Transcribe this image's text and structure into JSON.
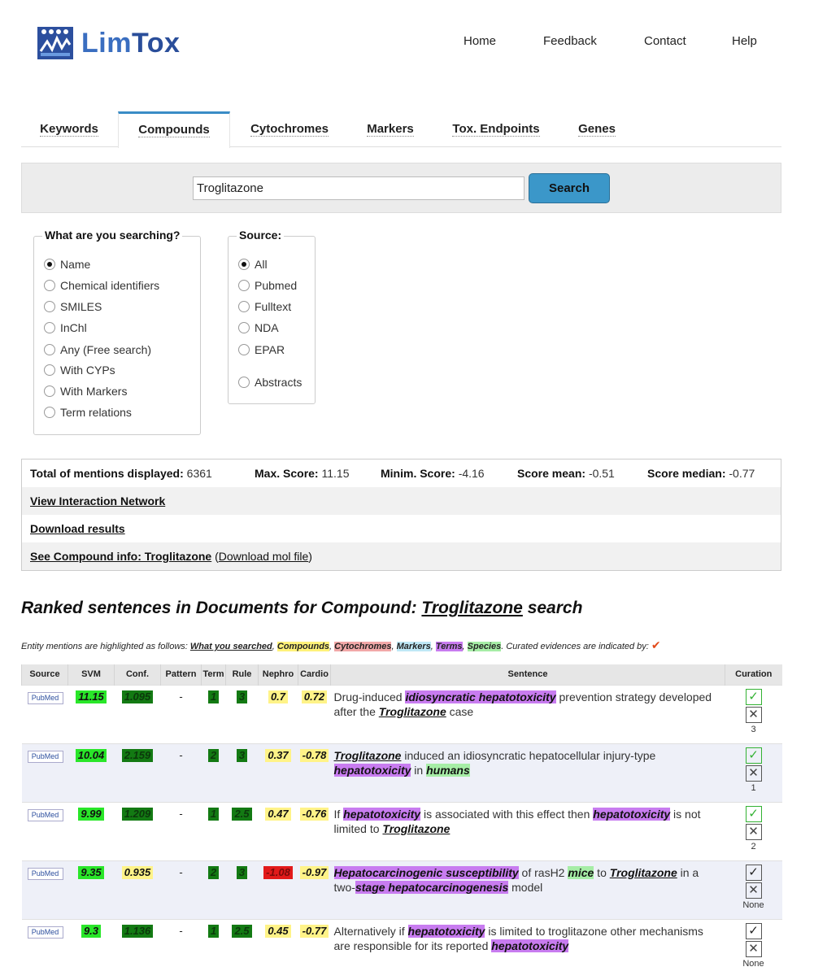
{
  "header": {
    "logo_lim": "Lim",
    "logo_tox": "Tox",
    "nav": [
      "Home",
      "Feedback",
      "Contact",
      "Help"
    ]
  },
  "tabs": [
    "Keywords",
    "Compounds",
    "Cytochromes",
    "Markers",
    "Tox. Endpoints",
    "Genes"
  ],
  "active_tab": "Compounds",
  "search": {
    "value": "Troglitazone",
    "button": "Search"
  },
  "searching": {
    "legend": "What are you searching?",
    "options": [
      "Name",
      "Chemical identifiers",
      "SMILES",
      "InChl",
      "Any (Free search)",
      "With CYPs",
      "With Markers",
      "Term relations"
    ],
    "selected": "Name"
  },
  "source": {
    "legend": "Source:",
    "options": [
      "All",
      "Pubmed",
      "Fulltext",
      "NDA",
      "EPAR",
      "Abstracts"
    ],
    "selected": "All"
  },
  "stats": {
    "total_label": "Total of mentions displayed:",
    "total": "6361",
    "max_label": "Max. Score:",
    "max": "11.15",
    "min_label": "Minim. Score:",
    "min": "-4.16",
    "mean_label": "Score mean:",
    "mean": "-0.51",
    "median_label": "Score median:",
    "median": "-0.77",
    "link_network": "View Interaction Network",
    "link_download": "Download results",
    "link_compound": "See Compound info: Troglitazone",
    "link_mol": "Download mol file"
  },
  "ranked": {
    "title_prefix": "Ranked sentences in Documents for Compound: ",
    "compound": "Troglitazone",
    "title_suffix": " search",
    "legend_intro": "Entity mentions are highlighted as follows: ",
    "legend_items": [
      "What you searched",
      "Compounds",
      "Cytochromes",
      "Markers",
      "Terms",
      "Species"
    ],
    "legend_outro": ". Curated evidences are indicated by: ",
    "check": "✔"
  },
  "table": {
    "headers": [
      "Source",
      "SVM",
      "Conf.",
      "Pattern",
      "Term",
      "Rule",
      "Nephro",
      "Cardio",
      "Sentence",
      "Curation"
    ],
    "source_badge": "PubMed",
    "rows": [
      {
        "svm": "11.15",
        "conf": "1.095",
        "pattern": "-",
        "term": "1",
        "rule": "3",
        "nephro": "0.7",
        "cardio": "0.72",
        "curation": "3"
      },
      {
        "svm": "10.04",
        "conf": "2.159",
        "pattern": "-",
        "term": "2",
        "rule": "3",
        "nephro": "0.37",
        "cardio": "-0.78",
        "curation": "1"
      },
      {
        "svm": "9.99",
        "conf": "1.209",
        "pattern": "-",
        "term": "1",
        "rule": "2.5",
        "nephro": "0.47",
        "cardio": "-0.76",
        "curation": "2"
      },
      {
        "svm": "9.35",
        "conf": "0.935",
        "pattern": "-",
        "term": "2",
        "rule": "3",
        "nephro": "-1.08",
        "cardio": "-0.97",
        "curation": "None"
      },
      {
        "svm": "9.3",
        "conf": "1.136",
        "pattern": "-",
        "term": "1",
        "rule": "2.5",
        "nephro": "0.45",
        "cardio": "-0.77",
        "curation": "None"
      }
    ],
    "sentences": {
      "s1_a": "Drug-induced ",
      "s1_t": "idiosyncratic hepatotoxicity",
      "s1_b": " prevention strategy developed after the ",
      "s1_u": "Troglitazone",
      "s1_c": " case",
      "s2_u": "Troglitazone",
      "s2_a": " induced an idiosyncratic hepatocellular injury-type ",
      "s2_t": "hepatotoxicity",
      "s2_b": " in ",
      "s2_s": "humans",
      "s3_a": "If ",
      "s3_t1": "hepatotoxicity",
      "s3_b": " is associated with this effect then ",
      "s3_t2": "hepatotoxicity",
      "s3_c": " is not limited to ",
      "s3_u": "Troglitazone",
      "s4_t1": "Hepatocarcinogenic susceptibility",
      "s4_a": " of rasH2 ",
      "s4_s": "mice",
      "s4_b": " to ",
      "s4_u": "Troglitazone",
      "s4_c": " in a two-",
      "s4_t2": "stage hepatocarcinogenesis",
      "s4_d": " model",
      "s5_a": "Alternatively if ",
      "s5_t1": "hepatotoxicity",
      "s5_b": " is limited to troglitazone other mechanisms are responsible for its reported ",
      "s5_t2": "hepatotoxicity"
    }
  },
  "colors": {
    "search_button": "#3b97c9",
    "tab_active_border": "#3a8cc6",
    "svm_badge": "#29e629",
    "dark_badge": "#137a13",
    "yellow_badge": "#fff388",
    "red_badge": "#e21a1a",
    "term_highlight": "#c87cf0",
    "species_highlight": "#a6eda6"
  }
}
